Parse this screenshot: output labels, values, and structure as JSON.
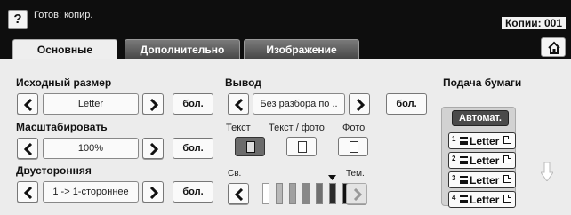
{
  "header": {
    "help_label": "?",
    "status": "Готов: копир.",
    "copies": "Копии: 001"
  },
  "tabs": [
    {
      "label": "Основные",
      "active": true
    },
    {
      "label": "Дополнительно",
      "active": false
    },
    {
      "label": "Изображение",
      "active": false
    }
  ],
  "original_size": {
    "label": "Исходный размер",
    "value": "Letter",
    "more": "бол."
  },
  "scale": {
    "label": "Масштабировать",
    "value": "100%",
    "more": "бол."
  },
  "duplex": {
    "label": "Двусторонняя",
    "value": "1 -> 1-стороннее",
    "more": "бол."
  },
  "output": {
    "label": "Вывод",
    "value": "Без разбора по ..",
    "more": "бол."
  },
  "original_type": {
    "options": [
      "Текст",
      "Текст / фото",
      "Фото"
    ],
    "selected": "Текст"
  },
  "darkness": {
    "light_label": "Св.",
    "dark_label": "Тем.",
    "level": 6,
    "levels": 7
  },
  "paper_supply": {
    "label": "Подача бумаги",
    "auto": "Автомат.",
    "trays": [
      {
        "num": "1",
        "size": "Letter"
      },
      {
        "num": "2",
        "size": "Letter"
      },
      {
        "num": "3",
        "size": "Letter"
      },
      {
        "num": "4",
        "size": "Letter"
      }
    ]
  },
  "colors": {
    "active_tab_bg": "#eeeeee",
    "header_bg": "#0e0e0e",
    "selected_mode": "#6b6b6b"
  }
}
